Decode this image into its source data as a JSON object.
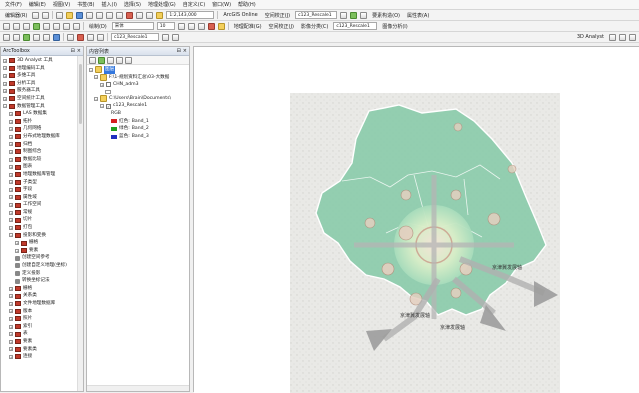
{
  "menubar": {
    "items": [
      "文件(F)",
      "编辑(E)",
      "视图(V)",
      "书签(B)",
      "插入(I)",
      "选择(S)",
      "地理处理(G)",
      "自定义(C)",
      "窗口(W)",
      "帮助(H)"
    ]
  },
  "toolbar1": {
    "editor": "编辑器(R)",
    "zoom_label": "1:2,143,000",
    "arcgis_online": "ArcGIS Online",
    "spatial_adjust": "空间校正(J)",
    "feature_label": "要素构造(O)",
    "attribute": "属性表(A)",
    "layer_field": "c123_Rescale1"
  },
  "toolbar2": {
    "font_name": "宋体",
    "font_size": "10",
    "draw_label": "绘制(D)",
    "georef": "地理配准(G)",
    "spatial_adjust2": "空间校正(J)",
    "image_label": "影像分类(C)",
    "raster_layer": "c123_Rescale1",
    "image_analysis": "图像分析(I)"
  },
  "toolbar3": {
    "analyst_3d": "3D Analyst",
    "layer": "c123_Rescale1"
  },
  "toolbox": {
    "title": "ArcToolbox",
    "items": [
      {
        "label": "3D Analyst 工具",
        "expanded": false,
        "tool": false
      },
      {
        "label": "地理编码工具",
        "expanded": false,
        "tool": false
      },
      {
        "label": "多维工具",
        "expanded": false,
        "tool": false
      },
      {
        "label": "分析工具",
        "expanded": false,
        "tool": false
      },
      {
        "label": "服务器工具",
        "expanded": false,
        "tool": false
      },
      {
        "label": "空间统计工具",
        "expanded": false,
        "tool": false
      },
      {
        "label": "数据管理工具",
        "expanded": true,
        "tool": false
      },
      {
        "label": "LAS 数据集",
        "expanded": false,
        "tool": false,
        "indent": 1
      },
      {
        "label": "拓扑",
        "expanded": false,
        "tool": false,
        "indent": 1
      },
      {
        "label": "几何网络",
        "expanded": false,
        "tool": false,
        "indent": 1
      },
      {
        "label": "分布式地理数据库",
        "expanded": false,
        "tool": false,
        "indent": 1
      },
      {
        "label": "归档",
        "expanded": false,
        "tool": false,
        "indent": 1
      },
      {
        "label": "制图综合",
        "expanded": false,
        "tool": false,
        "indent": 1
      },
      {
        "label": "数据比较",
        "expanded": false,
        "tool": false,
        "indent": 1
      },
      {
        "label": "图表",
        "expanded": false,
        "tool": false,
        "indent": 1
      },
      {
        "label": "地理数据库管理",
        "expanded": false,
        "tool": false,
        "indent": 1
      },
      {
        "label": "子类型",
        "expanded": false,
        "tool": false,
        "indent": 1
      },
      {
        "label": "字段",
        "expanded": false,
        "tool": false,
        "indent": 1
      },
      {
        "label": "属性域",
        "expanded": false,
        "tool": false,
        "indent": 1
      },
      {
        "label": "工作空间",
        "expanded": false,
        "tool": false,
        "indent": 1
      },
      {
        "label": "常规",
        "expanded": false,
        "tool": false,
        "indent": 1
      },
      {
        "label": "切片",
        "expanded": false,
        "tool": false,
        "indent": 1
      },
      {
        "label": "打包",
        "expanded": false,
        "tool": false,
        "indent": 1
      },
      {
        "label": "投影和变换",
        "expanded": true,
        "tool": false,
        "indent": 1
      },
      {
        "label": "栅格",
        "expanded": false,
        "tool": false,
        "indent": 2
      },
      {
        "label": "要素",
        "expanded": false,
        "tool": false,
        "indent": 2
      },
      {
        "label": "创建空间参考",
        "expanded": false,
        "tool": true,
        "indent": 2
      },
      {
        "label": "创建自定义地理(坐标)",
        "expanded": false,
        "tool": true,
        "indent": 2
      },
      {
        "label": "定义投影",
        "expanded": false,
        "tool": true,
        "indent": 2
      },
      {
        "label": "转换坐标记法",
        "expanded": false,
        "tool": true,
        "indent": 2
      },
      {
        "label": "栅格",
        "expanded": false,
        "tool": false,
        "indent": 1
      },
      {
        "label": "关系类",
        "expanded": false,
        "tool": false,
        "indent": 1
      },
      {
        "label": "文件地理数据库",
        "expanded": false,
        "tool": false,
        "indent": 1
      },
      {
        "label": "版本",
        "expanded": false,
        "tool": false,
        "indent": 1
      },
      {
        "label": "照片",
        "expanded": false,
        "tool": false,
        "indent": 1
      },
      {
        "label": "索引",
        "expanded": false,
        "tool": false,
        "indent": 1
      },
      {
        "label": "表",
        "expanded": false,
        "tool": false,
        "indent": 1
      },
      {
        "label": "要素",
        "expanded": false,
        "tool": false,
        "indent": 1
      },
      {
        "label": "要素类",
        "expanded": false,
        "tool": false,
        "indent": 1
      },
      {
        "label": "连接",
        "expanded": false,
        "tool": false,
        "indent": 1
      }
    ]
  },
  "toc": {
    "title": "内容列表",
    "layers_root": "图层",
    "group1": "F:\\1-规划资料汇总\\03-大数据",
    "layer1": "CHN_adm3",
    "group2": "C:\\Users\\Brain\\Documents\\",
    "layer2": "c123_Rescale1",
    "rgb": "RGB",
    "bands": [
      {
        "label": "红色:",
        "band": "Band_1",
        "color": "#d42020"
      },
      {
        "label": "绿色:",
        "band": "Band_2",
        "color": "#20a020"
      },
      {
        "label": "蓝色:",
        "band": "Band_3",
        "color": "#2030c0"
      }
    ]
  },
  "map": {
    "labels": [
      {
        "text": "京津冀发展轴",
        "key": "axis_south"
      },
      {
        "text": "京津发展轴",
        "key": "axis_se"
      },
      {
        "text": "京津冀发展轴",
        "key": "axis_east"
      }
    ]
  },
  "colors": {
    "accent": "#7fbfa0",
    "region_fill": "#8fd0b0",
    "core_fill": "#c7e9c0"
  }
}
